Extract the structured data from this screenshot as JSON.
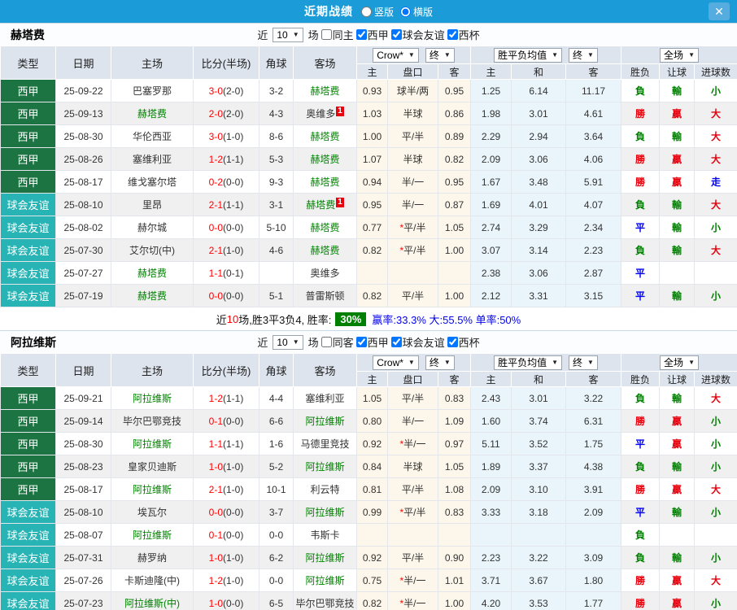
{
  "topbar": {
    "title": "近期战绩",
    "vertical_label": "竖版",
    "vertical_checked": false,
    "horizontal_label": "横版",
    "horizontal_checked": true,
    "close_glyph": "✕"
  },
  "colors": {
    "accent_blue": "#1B9BD8",
    "league_green": "#1B7441",
    "friendly_teal": "#28B4B4",
    "win_red": "#E8000D",
    "lose_green": "#008000",
    "draw_blue": "#0000EE",
    "score_red": "#FF0000",
    "rate_badge_green": "#008000",
    "odds_col_bg": "#FDF6EA",
    "avg_col_bg": "#EAF5FB"
  },
  "table_header": {
    "type": "类型",
    "date": "日期",
    "home": "主场",
    "score": "比分(半场)",
    "corner": "角球",
    "away": "客场",
    "dd_company": "Crow*",
    "dd_final": "终",
    "dd_avg": "胜平负均值",
    "dd_scope": "全场",
    "odds_home": "主",
    "odds_handicap": "盘口",
    "odds_away": "客",
    "avg_home": "主",
    "avg_draw": "和",
    "avg_away": "客",
    "result": "胜负",
    "let_goal": "让球",
    "goals": "进球数"
  },
  "sections": [
    {
      "team": "赫塔费",
      "filters": {
        "near": "近",
        "count": "10",
        "games": "场",
        "same_label": "同主",
        "same_checked": false,
        "league_label": "西甲",
        "league_checked": true,
        "friendly_label": "球会友谊",
        "friendly_checked": true,
        "cup_label": "西杯",
        "cup_checked": true
      },
      "rows": [
        {
          "type": "西甲",
          "type_style": "league",
          "date": "25-09-22",
          "home": "巴塞罗那",
          "home_green": false,
          "home_badge": "",
          "score_ft": "3-0",
          "score_ht": "2-0",
          "corner": "3-2",
          "away": "赫塔费",
          "away_green": true,
          "away_badge": "",
          "odds_home": "0.93",
          "handicap": "球半/两",
          "odds_away": "0.95",
          "avg_home": "1.25",
          "avg_draw": "6.14",
          "avg_away": "11.17",
          "result": "負",
          "let_result": "輸",
          "goals": "小"
        },
        {
          "type": "西甲",
          "type_style": "league",
          "date": "25-09-13",
          "home": "赫塔费",
          "home_green": true,
          "home_badge": "",
          "score_ft": "2-0",
          "score_ht": "2-0",
          "corner": "4-3",
          "away": "奥维多",
          "away_green": false,
          "away_badge": "1",
          "odds_home": "1.03",
          "handicap": "半球",
          "odds_away": "0.86",
          "avg_home": "1.98",
          "avg_draw": "3.01",
          "avg_away": "4.61",
          "result": "勝",
          "let_result": "贏",
          "goals": "大"
        },
        {
          "type": "西甲",
          "type_style": "league",
          "date": "25-08-30",
          "home": "华伦西亚",
          "home_green": false,
          "home_badge": "",
          "score_ft": "3-0",
          "score_ht": "1-0",
          "corner": "8-6",
          "away": "赫塔费",
          "away_green": true,
          "away_badge": "",
          "odds_home": "1.00",
          "handicap": "平/半",
          "odds_away": "0.89",
          "avg_home": "2.29",
          "avg_draw": "2.94",
          "avg_away": "3.64",
          "result": "負",
          "let_result": "輸",
          "goals": "大"
        },
        {
          "type": "西甲",
          "type_style": "league",
          "date": "25-08-26",
          "home": "塞维利亚",
          "home_green": false,
          "home_badge": "",
          "score_ft": "1-2",
          "score_ht": "1-1",
          "corner": "5-3",
          "away": "赫塔费",
          "away_green": true,
          "away_badge": "",
          "odds_home": "1.07",
          "handicap": "半球",
          "odds_away": "0.82",
          "avg_home": "2.09",
          "avg_draw": "3.06",
          "avg_away": "4.06",
          "result": "勝",
          "let_result": "贏",
          "goals": "大"
        },
        {
          "type": "西甲",
          "type_style": "league",
          "date": "25-08-17",
          "home": "维戈塞尔塔",
          "home_green": false,
          "home_badge": "",
          "score_ft": "0-2",
          "score_ht": "0-0",
          "corner": "9-3",
          "away": "赫塔费",
          "away_green": true,
          "away_badge": "",
          "odds_home": "0.94",
          "handicap": "半/一",
          "odds_away": "0.95",
          "avg_home": "1.67",
          "avg_draw": "3.48",
          "avg_away": "5.91",
          "result": "勝",
          "let_result": "贏",
          "goals": "走"
        },
        {
          "type": "球会友谊",
          "type_style": "friendly",
          "date": "25-08-10",
          "home": "里昂",
          "home_green": false,
          "home_badge": "",
          "score_ft": "2-1",
          "score_ht": "1-1",
          "corner": "3-1",
          "away": "赫塔费",
          "away_green": true,
          "away_badge": "1",
          "odds_home": "0.95",
          "handicap": "半/一",
          "odds_away": "0.87",
          "avg_home": "1.69",
          "avg_draw": "4.01",
          "avg_away": "4.07",
          "result": "負",
          "let_result": "輸",
          "goals": "大"
        },
        {
          "type": "球会友谊",
          "type_style": "friendly",
          "date": "25-08-02",
          "home": "赫尔城",
          "home_green": false,
          "home_badge": "",
          "score_ft": "0-0",
          "score_ht": "0-0",
          "corner": "5-10",
          "away": "赫塔费",
          "away_green": true,
          "away_badge": "",
          "odds_home": "0.77",
          "handicap": "*平/半",
          "odds_away": "1.05",
          "avg_home": "2.74",
          "avg_draw": "3.29",
          "avg_away": "2.34",
          "result": "平",
          "let_result": "輸",
          "goals": "小"
        },
        {
          "type": "球会友谊",
          "type_style": "friendly",
          "date": "25-07-30",
          "home": "艾尔切(中)",
          "home_green": false,
          "home_badge": "",
          "score_ft": "2-1",
          "score_ht": "1-0",
          "corner": "4-6",
          "away": "赫塔费",
          "away_green": true,
          "away_badge": "",
          "odds_home": "0.82",
          "handicap": "*平/半",
          "odds_away": "1.00",
          "avg_home": "3.07",
          "avg_draw": "3.14",
          "avg_away": "2.23",
          "result": "負",
          "let_result": "輸",
          "goals": "大"
        },
        {
          "type": "球会友谊",
          "type_style": "friendly",
          "date": "25-07-27",
          "home": "赫塔费",
          "home_green": true,
          "home_badge": "",
          "score_ft": "1-1",
          "score_ht": "0-1",
          "corner": "",
          "away": "奥维多",
          "away_green": false,
          "away_badge": "",
          "odds_home": "",
          "handicap": "",
          "odds_away": "",
          "avg_home": "2.38",
          "avg_draw": "3.06",
          "avg_away": "2.87",
          "result": "平",
          "let_result": "",
          "goals": ""
        },
        {
          "type": "球会友谊",
          "type_style": "friendly",
          "date": "25-07-19",
          "home": "赫塔费",
          "home_green": true,
          "home_badge": "",
          "score_ft": "0-0",
          "score_ht": "0-0",
          "corner": "5-1",
          "away": "普雷斯顿",
          "away_green": false,
          "away_badge": "",
          "odds_home": "0.82",
          "handicap": "平/半",
          "odds_away": "1.00",
          "avg_home": "2.12",
          "avg_draw": "3.31",
          "avg_away": "3.15",
          "result": "平",
          "let_result": "輸",
          "goals": "小"
        }
      ],
      "summary": {
        "near": "近",
        "count": "10",
        "text": "场,胜3平3负4, 胜率:",
        "rate": "30%",
        "stats": "赢率:33.3% 大:55.5% 单率:50%"
      }
    },
    {
      "team": "阿拉维斯",
      "filters": {
        "near": "近",
        "count": "10",
        "games": "场",
        "same_label": "同客",
        "same_checked": false,
        "league_label": "西甲",
        "league_checked": true,
        "friendly_label": "球会友谊",
        "friendly_checked": true,
        "cup_label": "西杯",
        "cup_checked": true
      },
      "rows": [
        {
          "type": "西甲",
          "type_style": "league",
          "date": "25-09-21",
          "home": "阿拉维斯",
          "home_green": true,
          "home_badge": "",
          "score_ft": "1-2",
          "score_ht": "1-1",
          "corner": "4-4",
          "away": "塞维利亚",
          "away_green": false,
          "away_badge": "",
          "odds_home": "1.05",
          "handicap": "平/半",
          "odds_away": "0.83",
          "avg_home": "2.43",
          "avg_draw": "3.01",
          "avg_away": "3.22",
          "result": "負",
          "let_result": "輸",
          "goals": "大"
        },
        {
          "type": "西甲",
          "type_style": "league",
          "date": "25-09-14",
          "home": "毕尔巴鄂竞技",
          "home_green": false,
          "home_badge": "",
          "score_ft": "0-1",
          "score_ht": "0-0",
          "corner": "6-6",
          "away": "阿拉维斯",
          "away_green": true,
          "away_badge": "",
          "odds_home": "0.80",
          "handicap": "半/一",
          "odds_away": "1.09",
          "avg_home": "1.60",
          "avg_draw": "3.74",
          "avg_away": "6.31",
          "result": "勝",
          "let_result": "贏",
          "goals": "小"
        },
        {
          "type": "西甲",
          "type_style": "league",
          "date": "25-08-30",
          "home": "阿拉维斯",
          "home_green": true,
          "home_badge": "",
          "score_ft": "1-1",
          "score_ht": "1-1",
          "corner": "1-6",
          "away": "马德里竞技",
          "away_green": false,
          "away_badge": "",
          "odds_home": "0.92",
          "handicap": "*半/一",
          "odds_away": "0.97",
          "avg_home": "5.11",
          "avg_draw": "3.52",
          "avg_away": "1.75",
          "result": "平",
          "let_result": "贏",
          "goals": "小"
        },
        {
          "type": "西甲",
          "type_style": "league",
          "date": "25-08-23",
          "home": "皇家贝迪斯",
          "home_green": false,
          "home_badge": "",
          "score_ft": "1-0",
          "score_ht": "1-0",
          "corner": "5-2",
          "away": "阿拉维斯",
          "away_green": true,
          "away_badge": "",
          "odds_home": "0.84",
          "handicap": "半球",
          "odds_away": "1.05",
          "avg_home": "1.89",
          "avg_draw": "3.37",
          "avg_away": "4.38",
          "result": "負",
          "let_result": "輸",
          "goals": "小"
        },
        {
          "type": "西甲",
          "type_style": "league",
          "date": "25-08-17",
          "home": "阿拉维斯",
          "home_green": true,
          "home_badge": "",
          "score_ft": "2-1",
          "score_ht": "1-0",
          "corner": "10-1",
          "away": "利云特",
          "away_green": false,
          "away_badge": "",
          "odds_home": "0.81",
          "handicap": "平/半",
          "odds_away": "1.08",
          "avg_home": "2.09",
          "avg_draw": "3.10",
          "avg_away": "3.91",
          "result": "勝",
          "let_result": "贏",
          "goals": "大"
        },
        {
          "type": "球会友谊",
          "type_style": "friendly",
          "date": "25-08-10",
          "home": "埃瓦尔",
          "home_green": false,
          "home_badge": "",
          "score_ft": "0-0",
          "score_ht": "0-0",
          "corner": "3-7",
          "away": "阿拉维斯",
          "away_green": true,
          "away_badge": "",
          "odds_home": "0.99",
          "handicap": "*平/半",
          "odds_away": "0.83",
          "avg_home": "3.33",
          "avg_draw": "3.18",
          "avg_away": "2.09",
          "result": "平",
          "let_result": "輸",
          "goals": "小"
        },
        {
          "type": "球会友谊",
          "type_style": "friendly",
          "date": "25-08-07",
          "home": "阿拉维斯",
          "home_green": true,
          "home_badge": "",
          "score_ft": "0-1",
          "score_ht": "0-0",
          "corner": "0-0",
          "away": "韦斯卡",
          "away_green": false,
          "away_badge": "",
          "odds_home": "",
          "handicap": "",
          "odds_away": "",
          "avg_home": "",
          "avg_draw": "",
          "avg_away": "",
          "result": "負",
          "let_result": "",
          "goals": ""
        },
        {
          "type": "球会友谊",
          "type_style": "friendly",
          "date": "25-07-31",
          "home": "赫罗纳",
          "home_green": false,
          "home_badge": "",
          "score_ft": "1-0",
          "score_ht": "1-0",
          "corner": "6-2",
          "away": "阿拉维斯",
          "away_green": true,
          "away_badge": "",
          "odds_home": "0.92",
          "handicap": "平/半",
          "odds_away": "0.90",
          "avg_home": "2.23",
          "avg_draw": "3.22",
          "avg_away": "3.09",
          "result": "負",
          "let_result": "輸",
          "goals": "小"
        },
        {
          "type": "球会友谊",
          "type_style": "friendly",
          "date": "25-07-26",
          "home": "卡斯迪隆(中)",
          "home_green": false,
          "home_badge": "",
          "score_ft": "1-2",
          "score_ht": "1-0",
          "corner": "0-0",
          "away": "阿拉维斯",
          "away_green": true,
          "away_badge": "",
          "odds_home": "0.75",
          "handicap": "*半/一",
          "odds_away": "1.01",
          "avg_home": "3.71",
          "avg_draw": "3.67",
          "avg_away": "1.80",
          "result": "勝",
          "let_result": "贏",
          "goals": "大"
        },
        {
          "type": "球会友谊",
          "type_style": "friendly",
          "date": "25-07-23",
          "home": "阿拉维斯(中)",
          "home_green": true,
          "home_badge": "",
          "score_ft": "1-0",
          "score_ht": "0-0",
          "corner": "6-5",
          "away": "毕尔巴鄂竞技",
          "away_green": false,
          "away_badge": "",
          "odds_home": "0.82",
          "handicap": "*半/一",
          "odds_away": "1.00",
          "avg_home": "4.20",
          "avg_draw": "3.53",
          "avg_away": "1.77",
          "result": "勝",
          "let_result": "贏",
          "goals": "小"
        }
      ],
      "summary": null
    }
  ]
}
